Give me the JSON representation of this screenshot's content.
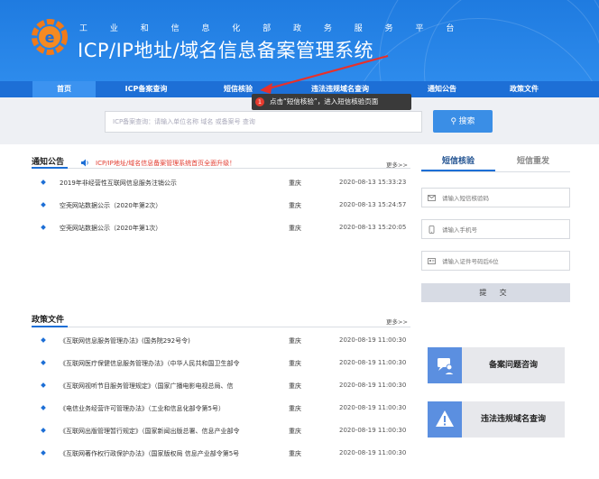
{
  "header": {
    "subtitle": "工 业 和 信 息 化 部 政 务 服 务 平 台",
    "title": "ICP/IP地址/域名信息备案管理系统"
  },
  "nav": {
    "items": [
      "首页",
      "ICP备案查询",
      "短信核验",
      "违法违规域名查询",
      "通知公告",
      "政策文件"
    ]
  },
  "tooltip": {
    "badge": "1",
    "text": "点击“短信核验”，进入短信核验页面"
  },
  "search": {
    "placeholder": "ICP备案查询：请输入单位名称 域名 或备案号 查询",
    "button": "搜索"
  },
  "notice": {
    "title": "通知公告",
    "banner": "ICP/IP地址/域名信息备案管理系统首页全面升级！",
    "more": "更多>>",
    "rows": [
      {
        "title": "2019年非经营性互联网信息服务注销公示",
        "location": "重庆",
        "datetime": "2020-08-13 15:33:23"
      },
      {
        "title": "空壳网站数据公示（2020年第2次）",
        "location": "重庆",
        "datetime": "2020-08-13 15:24:57"
      },
      {
        "title": "空壳网站数据公示（2020年第1次）",
        "location": "重庆",
        "datetime": "2020-08-13 15:20:05"
      }
    ]
  },
  "policy": {
    "title": "政策文件",
    "more": "更多>>",
    "rows": [
      {
        "title": "《互联网信息服务管理办法》(国务院292号令)",
        "location": "重庆",
        "datetime": "2020-08-19 11:00:30"
      },
      {
        "title": "《互联网医疗保健信息服务管理办法》（中华人民共和国卫生部令",
        "location": "重庆",
        "datetime": "2020-08-19 11:00:30"
      },
      {
        "title": "《互联网视听节目服务管理规定》（国家广播电影电视总局、信",
        "location": "重庆",
        "datetime": "2020-08-19 11:00:30"
      },
      {
        "title": "《电信业务经营许可管理办法》（工业和信息化部令第5号）",
        "location": "重庆",
        "datetime": "2020-08-19 11:00:30"
      },
      {
        "title": "《互联网出版管理暂行规定》（国家新闻出版总署、信息产业部令",
        "location": "重庆",
        "datetime": "2020-08-19 11:00:30"
      },
      {
        "title": "《互联网著作权行政保护办法》（国家版权局 信息产业部令第5号",
        "location": "重庆",
        "datetime": "2020-08-19 11:00:30"
      }
    ]
  },
  "sms_panel": {
    "tab_verify": "短信核验",
    "tab_resend": "短信重发",
    "code_placeholder": "请输入短信核验码",
    "phone_placeholder": "请输入手机号",
    "id_placeholder": "请输入证件号码后6位",
    "submit": "提 交"
  },
  "quick_links": {
    "consult": "备案问题咨询",
    "illegal_query": "违法违规域名查询"
  },
  "colors": {
    "brand_blue": "#1d6fd6",
    "accent_red": "#e23b2f"
  }
}
